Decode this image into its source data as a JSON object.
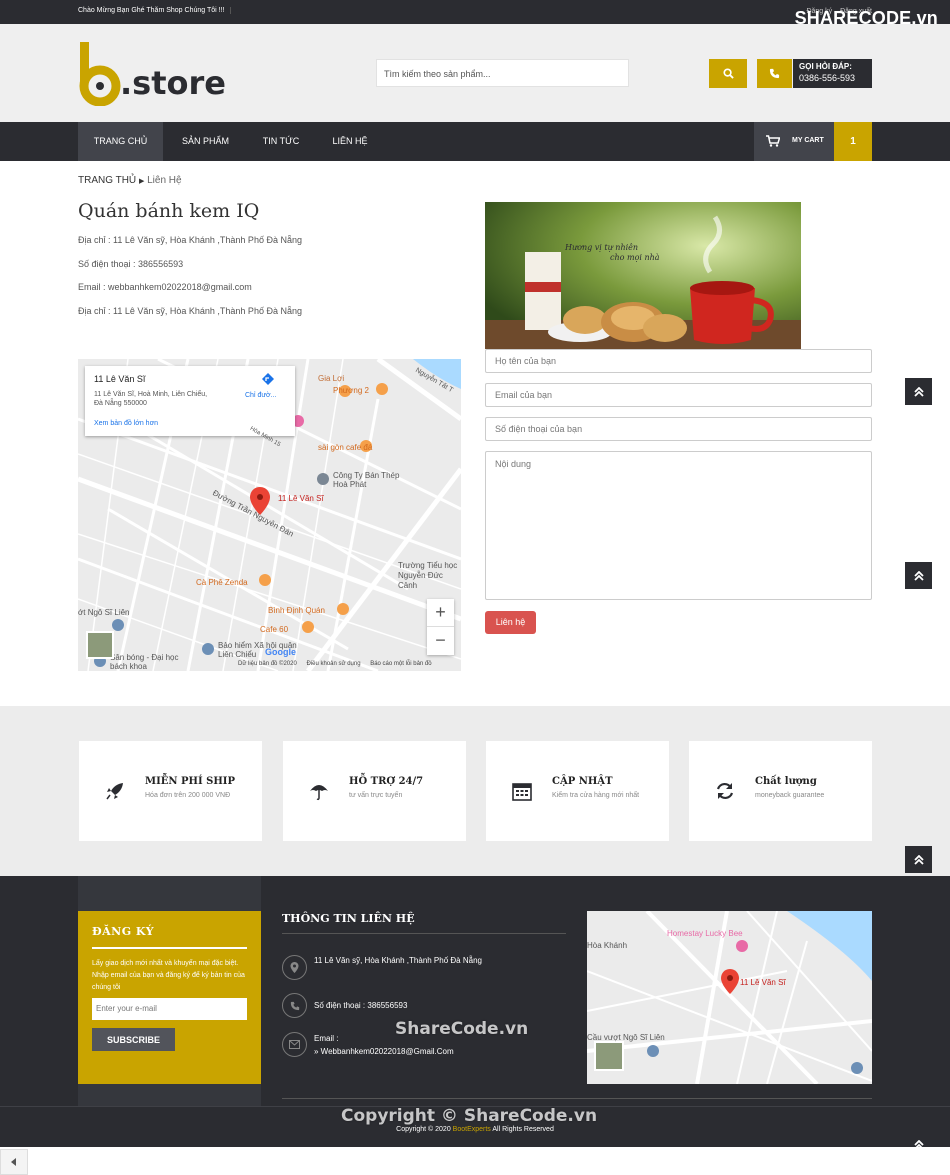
{
  "topbar": {
    "welcome": "Chào Mừng Bạn Ghé Thăm Shop Chúng Tôi !!!",
    "login": "Đăng ký",
    "logout": "Đăng xuất",
    "watermark_logo": "SHARECODE.vn"
  },
  "header": {
    "logo_text": ".store",
    "search_placeholder": "Tìm kiếm theo sản phẩm...",
    "hotline_label": "GỌI HỎI ĐÁP:",
    "hotline_number": "0386-556-593"
  },
  "nav": {
    "items": [
      "TRANG CHỦ",
      "SẢN PHẨM",
      "TIN TỨC",
      "LIÊN HỆ"
    ],
    "cart_label": "MY CART",
    "cart_count": "1"
  },
  "breadcrumb": {
    "home": "TRANG THỦ",
    "current": "Liên Hệ"
  },
  "shop": {
    "title": "Quán bánh kem IQ",
    "address": "Địa chỉ : 11 Lê Văn sỹ, Hòa Khánh ,Thành Phố Đà Nẵng",
    "phone": "Số điện thoại : 386556593",
    "email": "Email : webbanhkem02022018@gmail.com",
    "address2": "Địa chỉ : 11 Lê Văn sỹ, Hòa Khánh ,Thành Phố Đà Nẵng"
  },
  "map": {
    "place": "11 Lê Văn Sĩ",
    "place_address": "11 Lê Văn Sĩ, Hoà Minh, Liên Chiểu, Đà Nẵng 550000",
    "directions": "Chỉ đườ...",
    "larger_map": "Xem bản đồ lớn hơn",
    "labels": {
      "gia_loi": "Gia Lợi",
      "phuong2": "Phương 2",
      "saigon_cafe": "sài gòn cafe đá",
      "cong_ty": "Công Ty Bán Thép Hoà Phát",
      "pin": "11 Lê Văn Sĩ",
      "duong_tran": "Đường Trần Nguyên Đán",
      "truong": "Trường Tiểu học Nguyễn Đức Cảnh",
      "ca_phe_zenda": "Cà Phê Zenda",
      "binh_dinh": "Bình Định Quán",
      "cafe60": "Cafe 60",
      "ngo_si_lien": "ớt Ngô Sĩ Liên",
      "bao_hiem": "Bảo hiểm Xã hội quận Liên Chiểu",
      "san_bong": "Sân bóng - Đại học bách khoa",
      "hoa_minh_15": "Hòa Minh 15",
      "nguyen_tat": "Nguyễn Tất T"
    },
    "footer_links": [
      "Dữ liệu bản đồ ©2020",
      "Điều khoản sử dụng",
      "Báo cáo một lỗi bản đồ"
    ],
    "google": "Google"
  },
  "promo": {
    "caption_line1": "Hương vị tự nhiên",
    "caption_line2": "cho mọi nhà"
  },
  "form": {
    "name_placeholder": "Họ tên của bạn",
    "email_placeholder": "Email của bạn",
    "phone_placeholder": "Số điện thoại của bạn",
    "content_placeholder": "Nội dung",
    "submit": "Liên hệ"
  },
  "features": [
    {
      "title": "MIỄN PHÍ SHIP",
      "subtitle": "Hóa đơn trên 200 000 VNĐ",
      "icon": "rocket-icon"
    },
    {
      "title": "HỖ TRỢ 24/7",
      "subtitle": "tư vấn trực tuyến",
      "icon": "umbrella-icon"
    },
    {
      "title": "CẬP NHẬT",
      "subtitle": "Kiểm tra cửa hàng mới nhất",
      "icon": "calendar-icon"
    },
    {
      "title": "Chất lượng",
      "subtitle": "moneyback guarantee",
      "icon": "refresh-icon"
    }
  ],
  "footer": {
    "subscribe_heading": "ĐĂNG KÝ",
    "subscribe_text": "Lấy giao dịch mới nhất và khuyến mại đặc biệt. Nhập email của bạn và đăng ký để ký bản tin của chúng tôi",
    "email_placeholder": "Enter your e-mail",
    "subscribe_button": "SUBSCRIBE",
    "contact_heading": "THÔNG TIN LIÊN HỆ",
    "address": "11 Lê Văn sỹ, Hòa Khánh ,Thành Phố Đà Nẵng",
    "phone": "Số điện thoại : 386556593",
    "email_label": "Email :",
    "email": "Webbanhkem02022018@Gmail.Com",
    "map_labels": {
      "homestay": "Homestay Lucky Bee",
      "hoa_khanh": "Hòa Khánh",
      "pin": "11 Lê Văn Sĩ",
      "cau_vuot": "Cầu vượt Ngô Sĩ Liên"
    },
    "copyright_pre": "Copyright © 2020",
    "copyright_brand": "BootExperts",
    "copyright_post": "All Rights Reserved",
    "watermark_center": "ShareCode.vn",
    "watermark_copyright": "Copyright © ShareCode.vn"
  },
  "colors": {
    "accent": "#c9a400",
    "dark": "#2b2c31",
    "danger": "#d9534f"
  }
}
